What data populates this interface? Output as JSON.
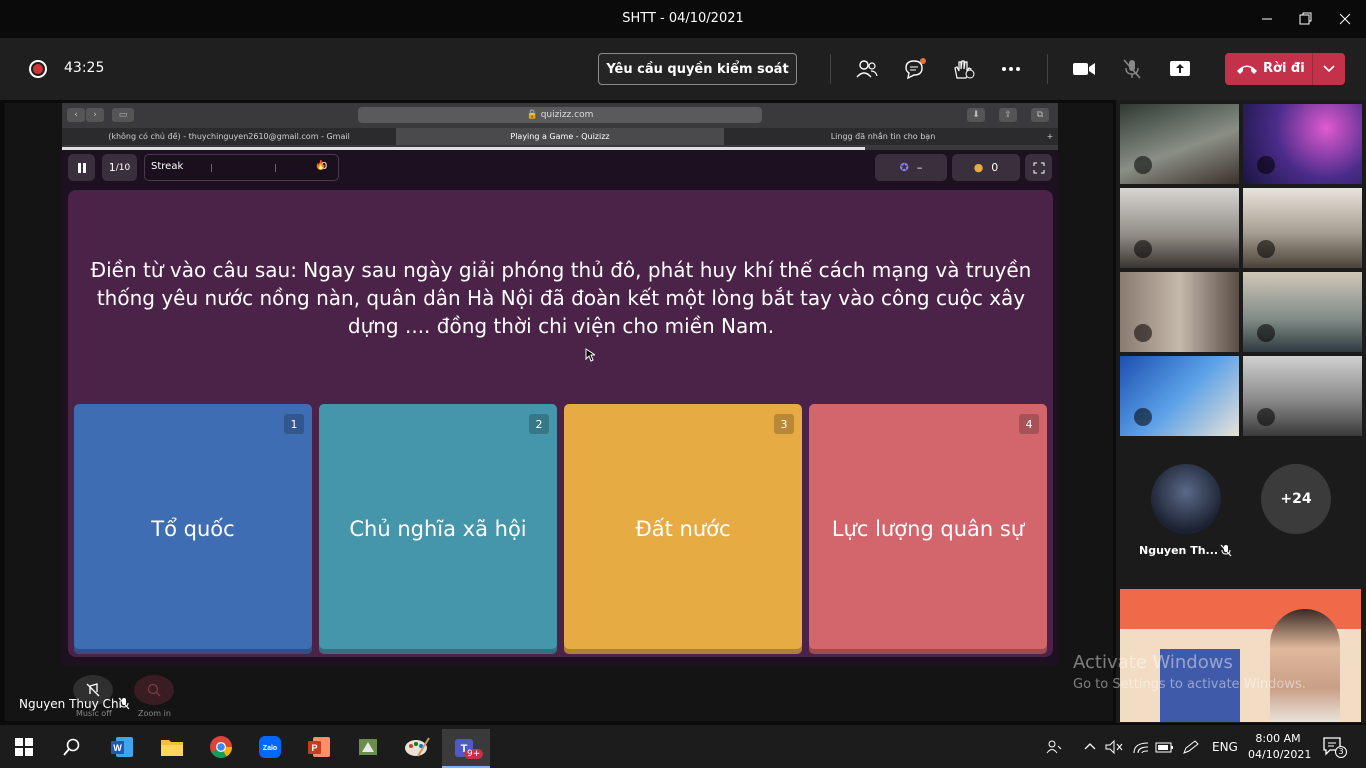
{
  "window": {
    "title": "SHTT - 04/10/2021"
  },
  "toolbar": {
    "timer": "43:25",
    "request_control_label": "Yêu cầu quyền kiểm soát",
    "leave_label": "Rời đi"
  },
  "browser": {
    "url": "quizizz.com",
    "tabs": [
      {
        "label": "(không có chủ đề) - thuychinguyen2610@gmail.com - Gmail"
      },
      {
        "label": "Playing a Game - Quizizz"
      },
      {
        "label": "Lingg đã nhắn tin cho bạn"
      }
    ]
  },
  "quiz": {
    "counter_current": "1",
    "counter_total": "/10",
    "streak_label": "Streak",
    "streak_value": "0",
    "rank": "–",
    "coins": "0",
    "question": "Điền từ vào câu sau: Ngay sau ngày giải phóng thủ đô, phát huy khí thế cách mạng và truyền thống yêu nước nồng nàn, quân dân Hà Nội đã đoàn kết một lòng bắt tay vào công cuộc xây dựng .... đồng thời chi viện cho miền Nam.",
    "options": [
      {
        "num": "1",
        "label": "Tổ quốc",
        "color": "#3f6db3"
      },
      {
        "num": "2",
        "label": "Chủ nghĩa xã hội",
        "color": "#4596ab"
      },
      {
        "num": "3",
        "label": "Đất nước",
        "color": "#e7ab44"
      },
      {
        "num": "4",
        "label": "Lực lượng quân sự",
        "color": "#d3666d"
      }
    ],
    "music_label": "Music off",
    "zoom_label": "Zoom in"
  },
  "presenter": {
    "name": "Nguyen Thuy Chi"
  },
  "participants": {
    "featured_name": "Nguyen Th...",
    "more_count": "+24"
  },
  "watermark": {
    "line1": "Activate Windows",
    "line2": "Go to Settings to activate Windows."
  },
  "taskbar": {
    "language": "ENG",
    "time": "8:00 AM",
    "date": "04/10/2021",
    "notifications": "3",
    "teams_badge": "9+"
  }
}
